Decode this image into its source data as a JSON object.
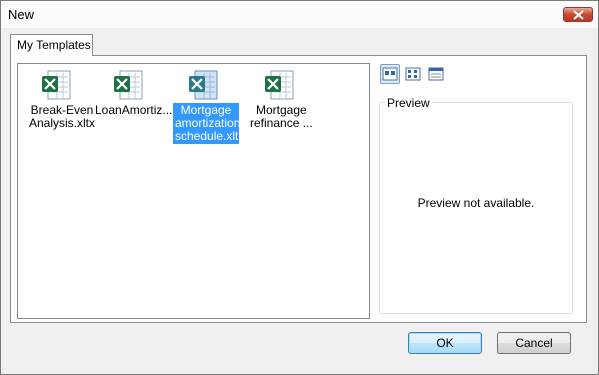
{
  "window": {
    "title": "New"
  },
  "tabs": [
    {
      "label": "My Templates"
    }
  ],
  "templates": [
    {
      "label": "Break-Even\nAnalysis.xltx",
      "icon": "excel-template-icon",
      "selected": false
    },
    {
      "label": "LoanAmortiz...",
      "icon": "excel-template-icon",
      "selected": false
    },
    {
      "label": "Mortgage\namortization\nschedule.xlt",
      "icon": "excel-template-icon",
      "selected": true
    },
    {
      "label": "Mortgage\nrefinance ...",
      "icon": "excel-template-icon",
      "selected": false
    }
  ],
  "view_buttons": [
    {
      "icon": "large-icons-view-icon",
      "active": true
    },
    {
      "icon": "list-view-icon",
      "active": false
    },
    {
      "icon": "details-view-icon",
      "active": false
    }
  ],
  "preview": {
    "label": "Preview",
    "message": "Preview not available."
  },
  "buttons": {
    "ok": "OK",
    "cancel": "Cancel"
  },
  "colors": {
    "selection": "#3399ff",
    "excel_green": "#1e7145",
    "close_red": "#c9482f"
  }
}
